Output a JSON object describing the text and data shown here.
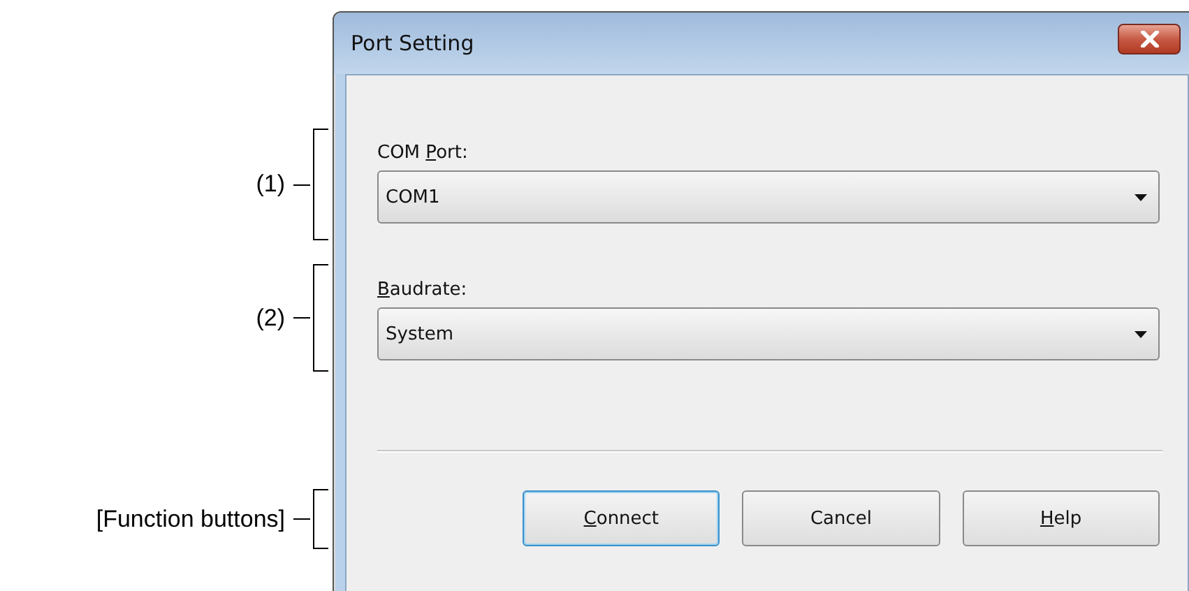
{
  "callouts": [
    {
      "label": "(1)"
    },
    {
      "label": "(2)"
    },
    {
      "label": "[Function buttons]"
    }
  ],
  "window": {
    "title": "Port Setting"
  },
  "fields": [
    {
      "label": {
        "before": "COM ",
        "key": "P",
        "after": "ort:"
      },
      "value": "COM1"
    },
    {
      "label": {
        "key": "B",
        "after": "audrate:"
      },
      "value": "System"
    }
  ],
  "buttons": [
    {
      "key": "C",
      "after": "onnect",
      "default": true
    },
    {
      "before": "Cancel",
      "default": false
    },
    {
      "key": "H",
      "after": "elp",
      "default": false
    }
  ]
}
